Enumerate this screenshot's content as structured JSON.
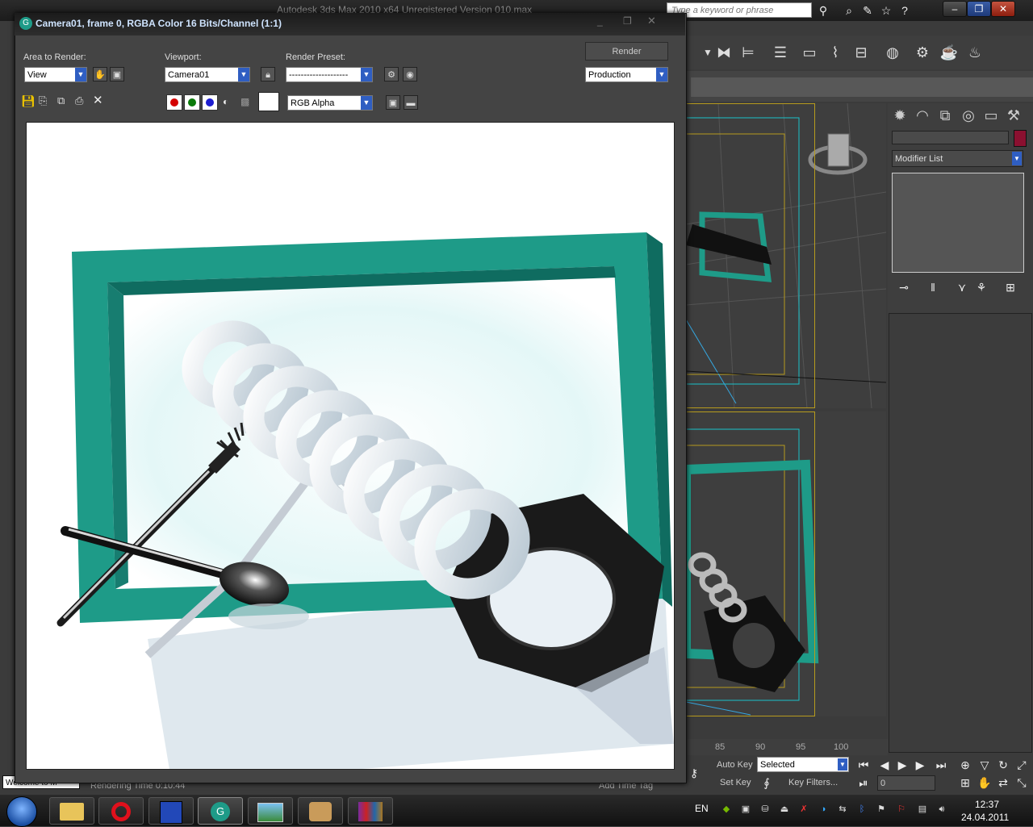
{
  "max_window": {
    "title": "Autodesk 3ds Max  2010 x64    Unregistered Version    010.max",
    "search_placeholder": "Type a keyword or phrase",
    "command_panel": {
      "modifier_list": "Modifier List"
    },
    "timeline_ticks": [
      "85",
      "90",
      "95",
      "100"
    ],
    "anim": {
      "auto_key": "Auto Key",
      "set_key": "Set Key",
      "selected": "Selected",
      "key_filters": "Key Filters...",
      "frame": "0"
    },
    "status": {
      "listener": "Welcome to M",
      "rendering_time": "Rendering Time  0:10:44",
      "add_time_tag": "Add Time Tag"
    }
  },
  "render_window": {
    "title": "Camera01, frame 0, RGBA Color 16 Bits/Channel (1:1)",
    "area_label": "Area to Render:",
    "area_value": "View",
    "viewport_label": "Viewport:",
    "viewport_value": "Camera01",
    "preset_label": "Render Preset:",
    "preset_value": "--------------------",
    "render_button": "Render",
    "production_value": "Production",
    "channel_value": "RGB Alpha",
    "channel_colors": {
      "red": "#d40000",
      "green": "#0a7a0a",
      "blue": "#1d1dd0"
    }
  },
  "taskbar": {
    "lang": "EN",
    "time": "12:37",
    "date": "24.04.2011"
  },
  "colors": {
    "frame_teal": "#1e9b88",
    "accent_blue": "#2f5ec2",
    "viewport_gold": "#b79b1e",
    "viewport_cyan": "#19c3c9"
  }
}
